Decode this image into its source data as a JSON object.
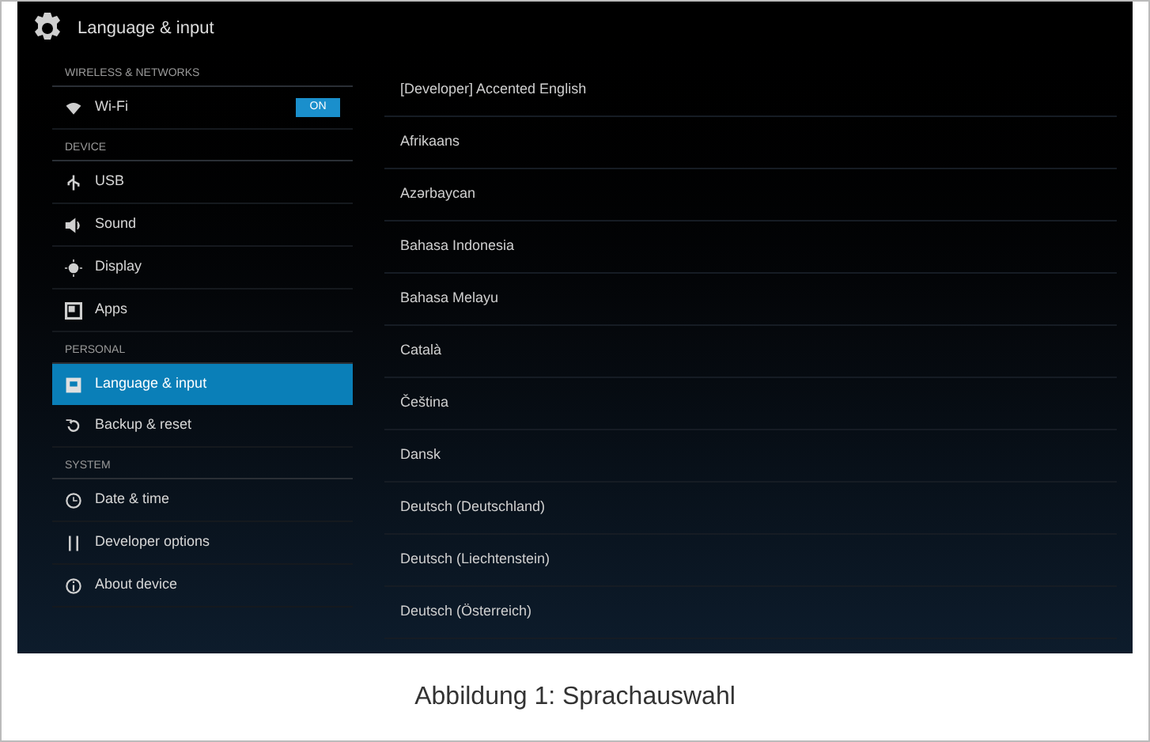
{
  "window": {
    "title": "Language & input"
  },
  "sidebar": {
    "sections": [
      {
        "header": "WIRELESS & NETWORKS",
        "items": [
          {
            "label": "Wi-Fi",
            "kind": "wifi",
            "switch": {
              "label": "ON",
              "on": true
            },
            "selected": false
          }
        ]
      },
      {
        "header": "DEVICE",
        "items": [
          {
            "label": "USB",
            "kind": "usb",
            "selected": false
          },
          {
            "label": "Sound",
            "kind": "sound",
            "selected": false
          },
          {
            "label": "Display",
            "kind": "display",
            "selected": false
          },
          {
            "label": "Apps",
            "kind": "apps",
            "selected": false
          }
        ]
      },
      {
        "header": "PERSONAL",
        "items": [
          {
            "label": "Language & input",
            "kind": "language",
            "selected": true
          },
          {
            "label": "Backup & reset",
            "kind": "backup",
            "selected": false
          }
        ]
      },
      {
        "header": "SYSTEM",
        "items": [
          {
            "label": "Date & time",
            "kind": "clock",
            "selected": false
          },
          {
            "label": "Developer options",
            "kind": "dev",
            "selected": false
          },
          {
            "label": "About device",
            "kind": "info",
            "selected": false
          }
        ]
      }
    ]
  },
  "languages": [
    "[Developer] Accented English",
    "Afrikaans",
    "Azərbaycan",
    "Bahasa Indonesia",
    "Bahasa Melayu",
    "Català",
    "Čeština",
    "Dansk",
    "Deutsch (Deutschland)",
    "Deutsch (Liechtenstein)",
    "Deutsch (Österreich)"
  ],
  "caption": "Abbildung 1: Sprachauswahl"
}
